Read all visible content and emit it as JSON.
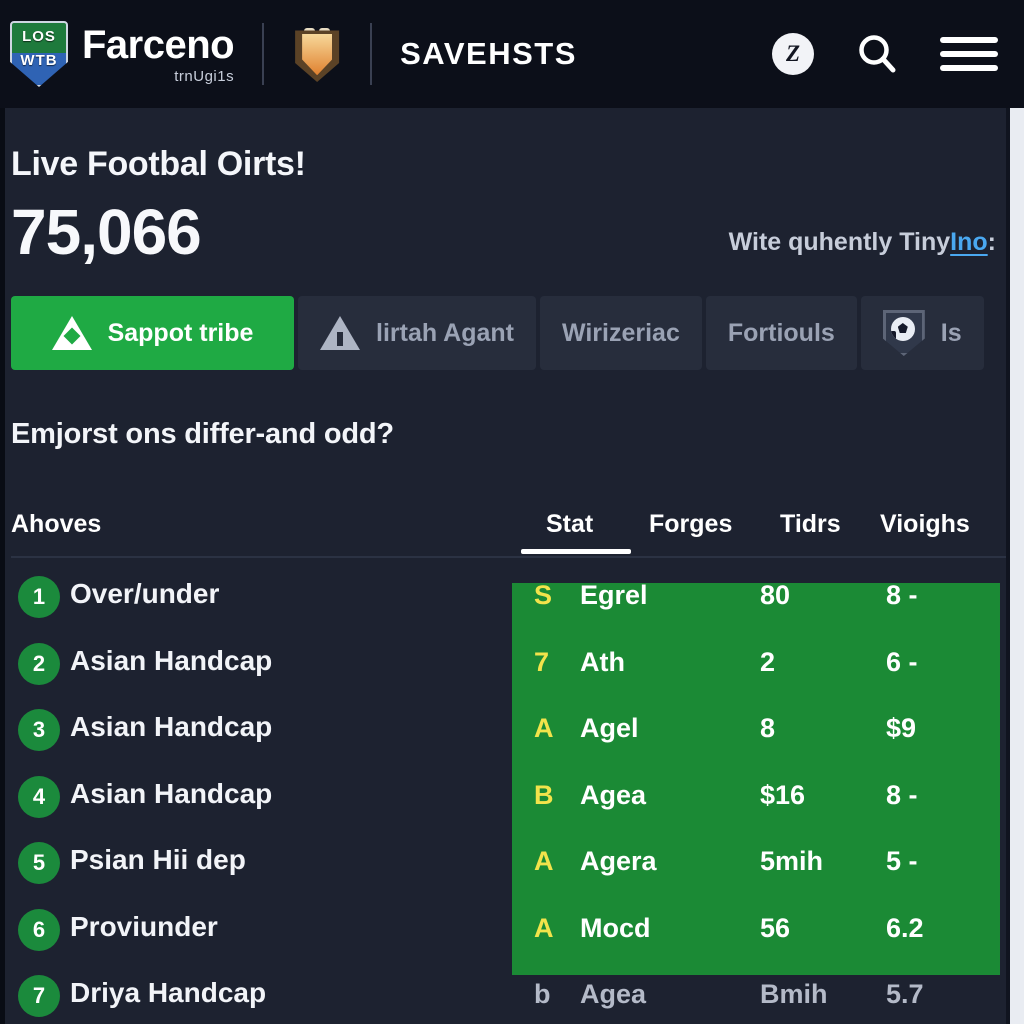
{
  "header": {
    "logo": {
      "shield_top": "LOS",
      "shield_bottom": "WTB",
      "icon": "shield-badge-icon"
    },
    "brand_name": "Farceno",
    "brand_sub": "trnUgi1s",
    "crest_icon": "crest-emblem-icon",
    "section_label": "SAVEHSTS",
    "avatar_initial": "Z",
    "avatar_icon": "avatar-icon",
    "search_icon": "search-icon",
    "menu_icon": "hamburger-menu-icon"
  },
  "hero": {
    "title": "Live Footbal Oirts!",
    "count": "75,066",
    "note_text": "Wite quhently Tiny",
    "note_link": "Ino",
    "note_suffix": ":"
  },
  "tabs": [
    {
      "label": "Sappot tribe",
      "icon": "triangle-peak-icon",
      "active": true
    },
    {
      "label": "lirtah Agant",
      "icon": "warning-triangle-icon",
      "active": false
    },
    {
      "label": "Wirizeriac",
      "icon": "",
      "active": false
    },
    {
      "label": "Fortiouls",
      "icon": "",
      "active": false
    },
    {
      "label": "Is",
      "icon": "soccer-ball-shield-icon",
      "active": false
    }
  ],
  "section": {
    "heading": "Emjorst ons differ-and odd?"
  },
  "table": {
    "columns": [
      "Ahoves",
      "Stat",
      "Forges",
      "Tidrs",
      "Vioighs"
    ],
    "active_column": "Stat",
    "rows": [
      {
        "num": "1",
        "label": "Over/under",
        "code": "S",
        "name": "Egrel",
        "val": "80",
        "odds": "8 -",
        "highlighted": true
      },
      {
        "num": "2",
        "label": "Asian Handcap",
        "code": "7",
        "name": "Ath",
        "val": "2",
        "odds": "6 -",
        "highlighted": true
      },
      {
        "num": "3",
        "label": "Asian Handcap",
        "code": "A",
        "name": "Agel",
        "val": "8",
        "odds": "$9",
        "highlighted": true
      },
      {
        "num": "4",
        "label": "Asian Handcap",
        "code": "B",
        "name": "Agea",
        "val": "$16",
        "odds": "8 -",
        "highlighted": true
      },
      {
        "num": "5",
        "label": "Psian Hii dep",
        "code": "A",
        "name": "Agera",
        "val": "5mih",
        "odds": "5 -",
        "highlighted": true
      },
      {
        "num": "6",
        "label": "Proviunder",
        "code": "A",
        "name": "Mocd",
        "val": "56",
        "odds": "6.2",
        "highlighted": true
      },
      {
        "num": "7",
        "label": "Driya Handcap",
        "code": "b",
        "name": "Agea",
        "val": "Bmih",
        "odds": "5.7",
        "highlighted": false
      }
    ]
  },
  "colors": {
    "page_bg": "#1d2230",
    "header_bg": "#0c0f19",
    "accent_green": "#1faa44",
    "panel_green": "#1b8a35",
    "badge_green": "#1b8a3c",
    "link_blue": "#4aa8f0",
    "code_yellow": "#f2e34b",
    "tab_bg": "#272d3c"
  }
}
